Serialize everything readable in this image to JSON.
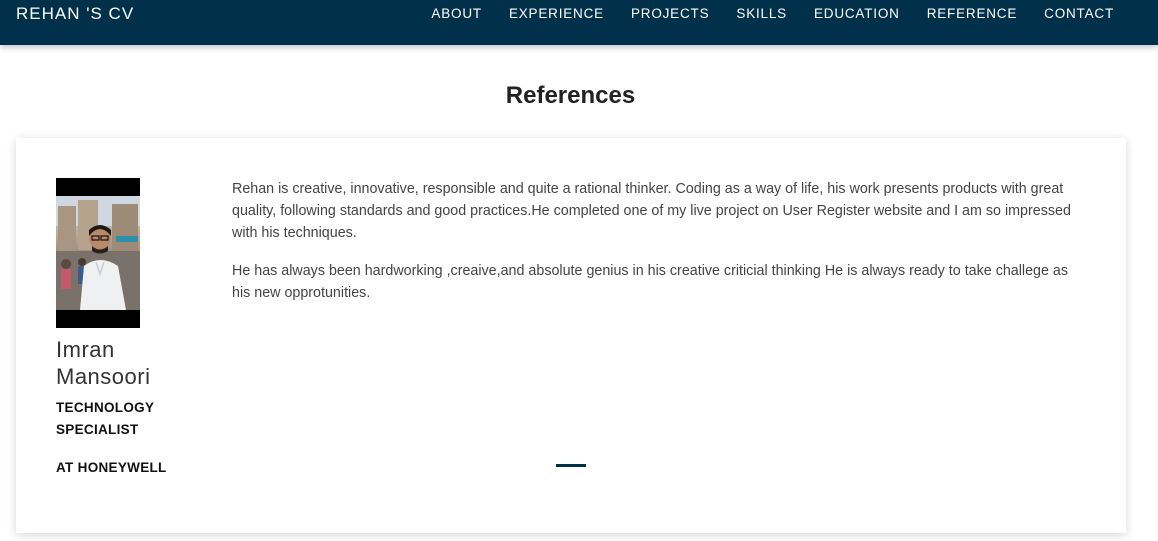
{
  "navbar": {
    "brand": "REHAN 'S CV",
    "links": [
      "ABOUT",
      "EXPERIENCE",
      "PROJECTS",
      "SKILLS",
      "EDUCATION",
      "REFERENCE",
      "CONTACT"
    ]
  },
  "section": {
    "title": "References"
  },
  "reference": {
    "name": "Imran Mansoori",
    "role": "TECHNOLOGY SPECIALIST",
    "company": "AT HONEYWELL",
    "paragraphs": [
      "Rehan is creative, innovative, responsible and quite a rational thinker. Coding as a way of life, his work presents products with great quality, following standards and good practices.He completed one of my live project on User Register website and I am so impressed with his techniques.",
      "He has always been hardworking ,creaive,and absolute genius in his creative criticial thinking He is always ready to take challege as his new opprotunities."
    ]
  },
  "colors": {
    "navbar": "#01304a",
    "indicator": "#01304a"
  }
}
